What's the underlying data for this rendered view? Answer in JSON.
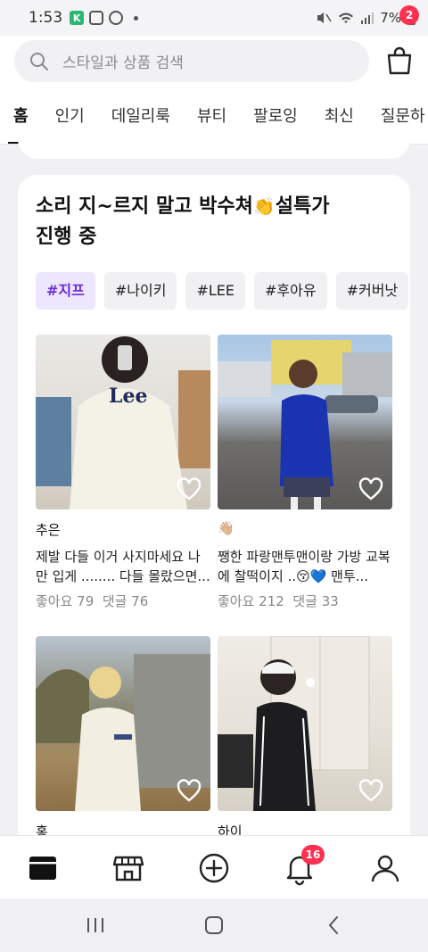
{
  "status_bar": {
    "time": "1:53",
    "battery": "7%"
  },
  "search": {
    "placeholder": "스타일과 상품 검색"
  },
  "cart": {
    "badge": "2"
  },
  "tabs": [
    {
      "label": "홈",
      "active": true
    },
    {
      "label": "인기"
    },
    {
      "label": "데일리룩"
    },
    {
      "label": "뷰티"
    },
    {
      "label": "팔로잉"
    },
    {
      "label": "최신"
    },
    {
      "label": "질문하"
    }
  ],
  "card": {
    "title_line1": "소리 지~르지 말고 박수쳐",
    "title_emoji": "👏",
    "title_line1_tail": "설특가",
    "title_line2": "진행 중",
    "tags": [
      "#지프",
      "#나이키",
      "#LEE",
      "#후아유",
      "#커버낫"
    ],
    "posts": [
      {
        "author": "추은",
        "desc": "제발 다들 이거 사지마세요 나만 입게 ........ 다들 몰랐으면...",
        "likes": "좋아요 79",
        "comments": "댓글 76"
      },
      {
        "author": "👋🏼",
        "desc": "쨍한 파랑맨투맨이랑 가방 교복에 찰떡이지 ..😚💙 맨투...",
        "likes": "좋아요 212",
        "comments": "댓글 33"
      },
      {
        "author": "홍",
        "desc": "",
        "likes": "",
        "comments": ""
      },
      {
        "author": "하이",
        "desc": "",
        "likes": "",
        "comments": ""
      }
    ]
  },
  "bottom_nav": {
    "notification_badge": "16"
  },
  "colors": {
    "accent": "#6a2bd9",
    "badge": "#ff3050"
  }
}
